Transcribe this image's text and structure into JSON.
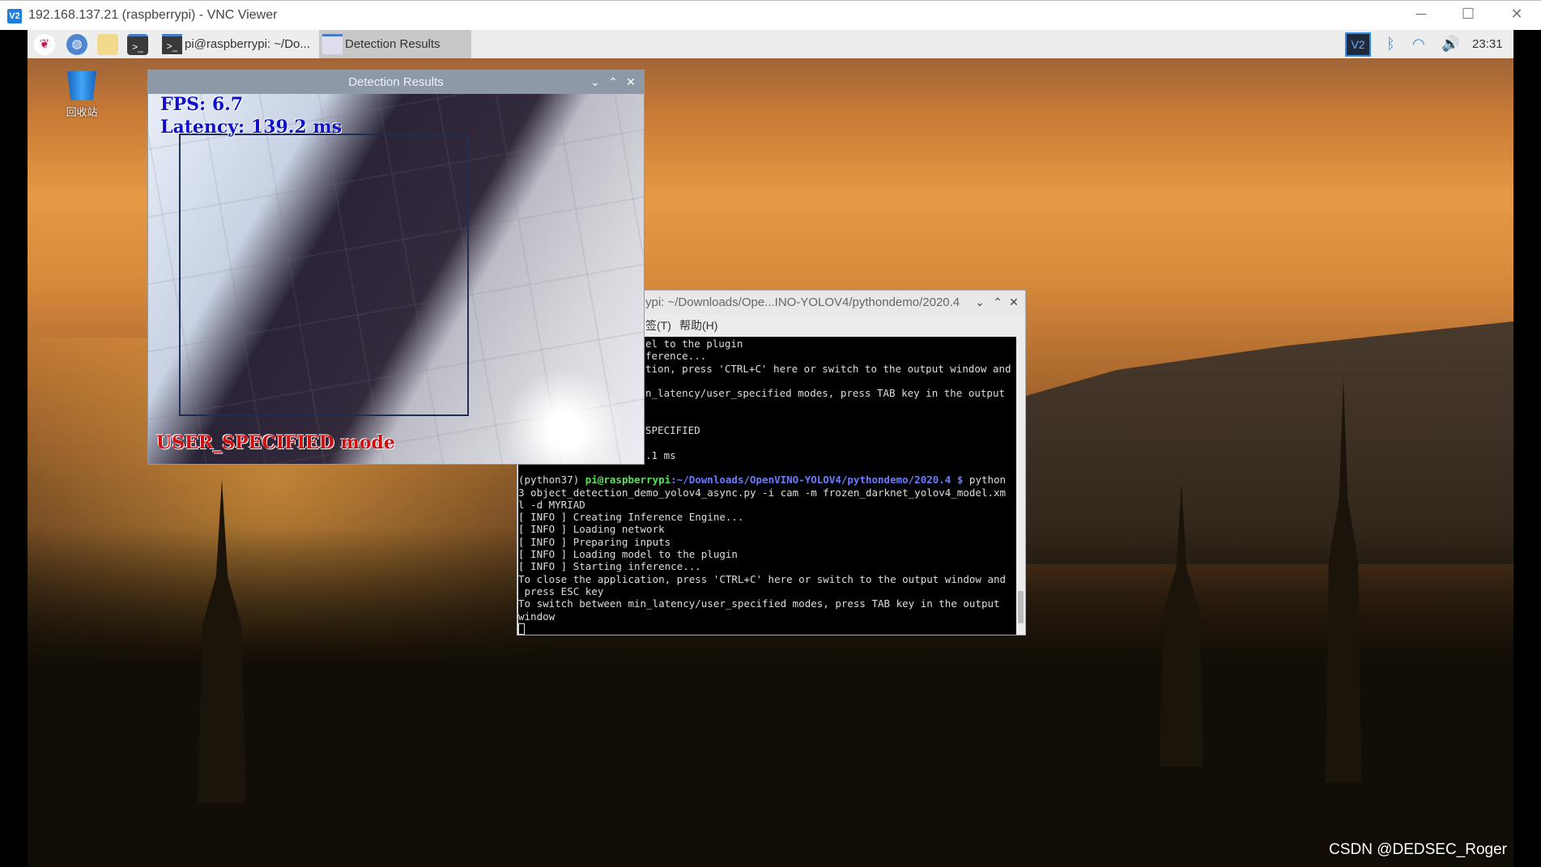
{
  "vnc_window": {
    "title": "192.168.137.21 (raspberrypi) - VNC Viewer",
    "logo": "V2",
    "controls": [
      "minimize-icon",
      "maximize-icon",
      "close-icon"
    ]
  },
  "taskbar": {
    "launchers": [
      "raspberry-menu-icon",
      "web-browser-icon",
      "file-manager-icon",
      "terminal-icon"
    ],
    "tasks": [
      {
        "label": "pi@raspberrypi: ~/Do...",
        "icon": "terminal-icon"
      },
      {
        "label": "Detection Results",
        "icon": "window-icon",
        "active": true
      }
    ],
    "tray": {
      "icons": [
        "vnc-icon",
        "bluetooth-icon",
        "wifi-icon",
        "volume-icon"
      ],
      "clock": "23:31"
    }
  },
  "desktop": {
    "recycle_bin_label": "回收站"
  },
  "detection_window": {
    "title": "Detection Results",
    "fps": "FPS: 6.7",
    "latency": "Latency: 139.2 ms",
    "mode": "USER_SPECIFIED mode",
    "colors": {
      "overlay_text": "#1010c8",
      "mode_text": "#d01010",
      "box": "#1f2e55"
    }
  },
  "terminal": {
    "title": "ypi: ~/Downloads/Ope...INO-YOLOV4/pythondemo/2020.4",
    "menu": [
      "签(T)",
      "帮助(H)"
    ],
    "partial_lines": [
      "el to the plugin",
      "ference...",
      "tion, press 'CTRL+C' here or switch to the output window and",
      "",
      "n_latency/user_specified modes, press TAB key in the output",
      "",
      "",
      "SPECIFIED",
      "",
      ".1 ms",
      ""
    ],
    "prompt": {
      "env": "(python37) ",
      "user_host": "pi@raspberrypi",
      "path": ":~/Downloads/OpenVINO-YOLOV4/pythondemo/2020.4 $",
      "cmd": " python"
    },
    "lines": [
      "3 object_detection_demo_yolov4_async.py -i cam -m frozen_darknet_yolov4_model.xm",
      "l -d MYRIAD",
      "[ INFO ] Creating Inference Engine...",
      "[ INFO ] Loading network",
      "[ INFO ] Preparing inputs",
      "[ INFO ] Loading model to the plugin",
      "[ INFO ] Starting inference...",
      "To close the application, press 'CTRL+C' here or switch to the output window and",
      " press ESC key",
      "To switch between min_latency/user_specified modes, press TAB key in the output",
      "window"
    ]
  },
  "watermark": "CSDN @DEDSEC_Roger"
}
